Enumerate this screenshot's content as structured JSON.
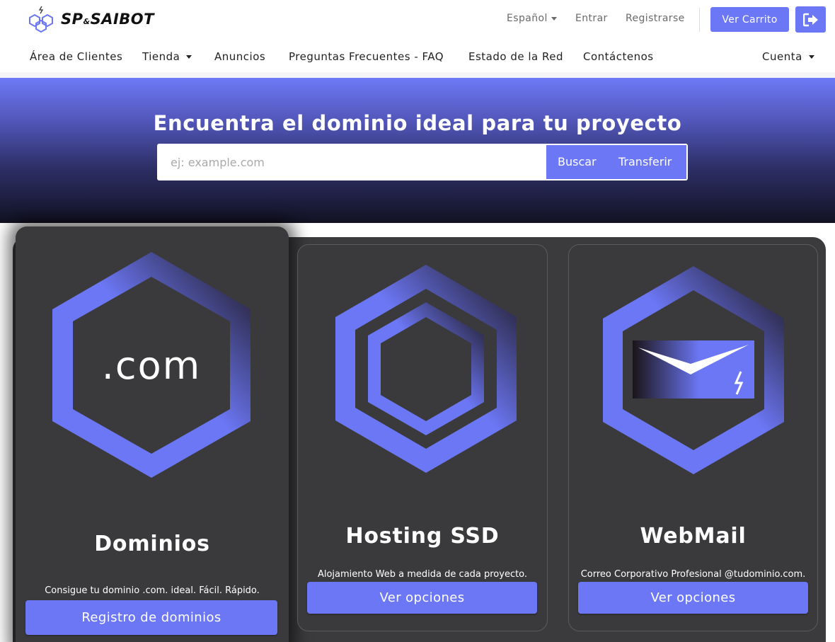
{
  "brand": {
    "name_left": "SP",
    "name_amp": "&",
    "name_right": "SAIBOT"
  },
  "topnav": {
    "language": "Español",
    "login": "Entrar",
    "register": "Registrarse",
    "cart": "Ver Carrito"
  },
  "mainnav": {
    "items": [
      "Área de Clientes",
      "Tienda",
      "Anuncios",
      "Preguntas Frecuentes - FAQ",
      "Estado de la Red",
      "Contáctenos"
    ],
    "account": "Cuenta"
  },
  "hero": {
    "title": "Encuentra el dominio ideal para tu proyecto",
    "search_placeholder": "ej: example.com",
    "search_label": "Buscar",
    "transfer_label": "Transferir"
  },
  "cards": [
    {
      "emblem_text": ".com",
      "title": "Dominios",
      "description": "Consigue tu dominio .com. ideal. Fácil. Rápido.",
      "button": "Registro de dominios"
    },
    {
      "title": "Hosting SSD",
      "description": "Alojamiento Web a medida de cada proyecto.",
      "button": "Ver opciones"
    },
    {
      "title": "WebMail",
      "description": "Correo Corporativo Profesional @tudominio.com.",
      "button": "Ver opciones"
    }
  ],
  "colors": {
    "accent": "#6c77f5",
    "panel": "#3b3b3d",
    "hero_top": "#6e79f7",
    "hero_bottom": "#121223"
  }
}
